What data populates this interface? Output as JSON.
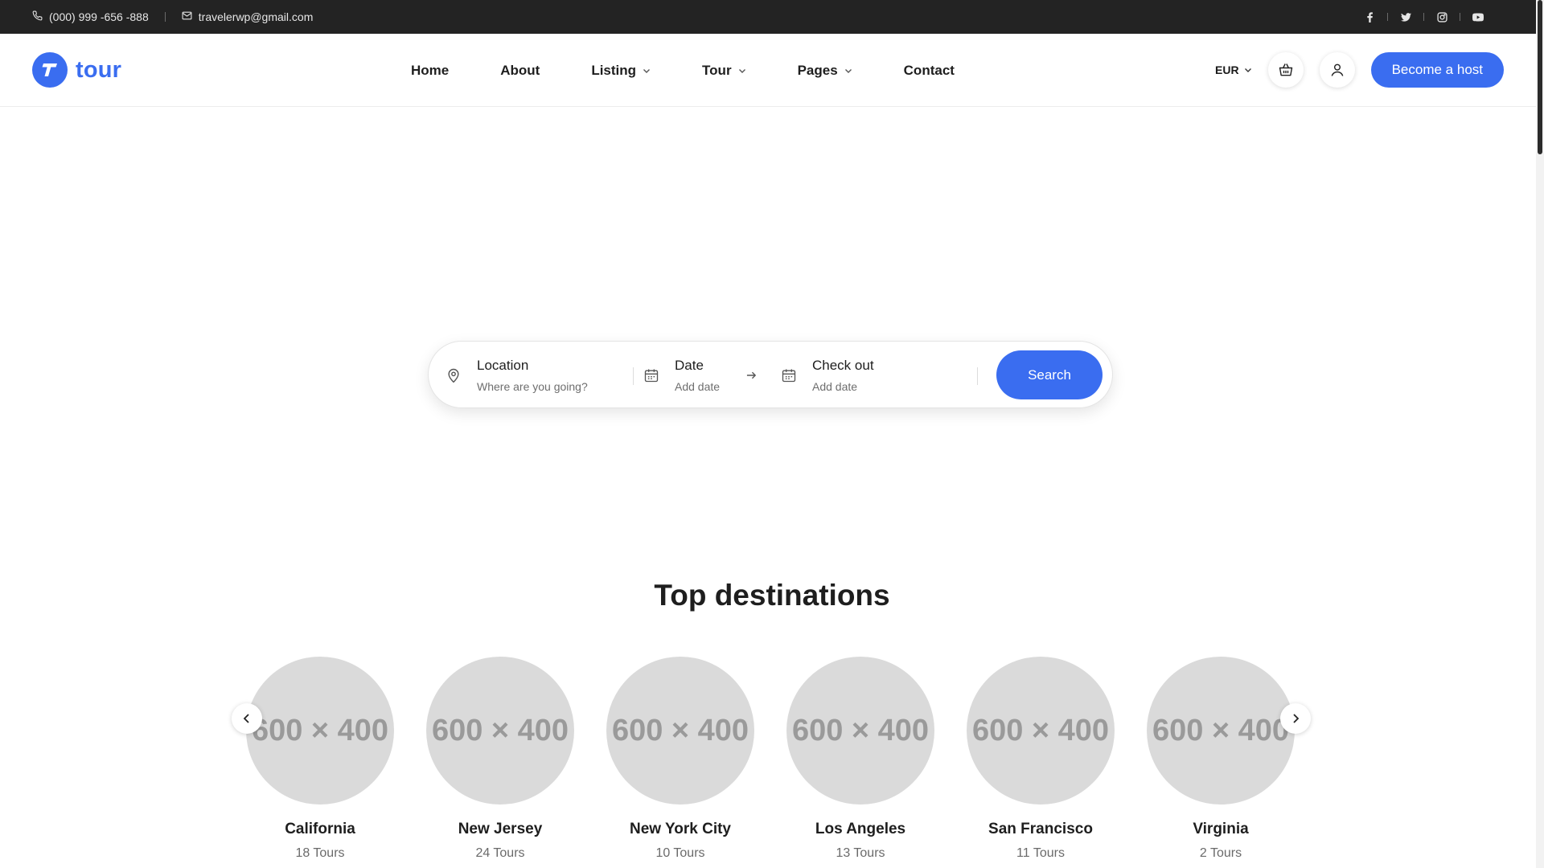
{
  "topbar": {
    "phone": "(000) 999 -656 -888",
    "email": "travelerwp@gmail.com",
    "social": [
      "facebook-icon",
      "twitter-icon",
      "instagram-icon",
      "youtube-icon"
    ]
  },
  "header": {
    "logo_text": "tour",
    "nav": [
      {
        "label": "Home",
        "dropdown": false
      },
      {
        "label": "About",
        "dropdown": false
      },
      {
        "label": "Listing",
        "dropdown": true
      },
      {
        "label": "Tour",
        "dropdown": true
      },
      {
        "label": "Pages",
        "dropdown": true
      },
      {
        "label": "Contact",
        "dropdown": false
      }
    ],
    "currency": "EUR",
    "become_host": "Become a host"
  },
  "search": {
    "location_label": "Location",
    "location_placeholder": "Where are you going?",
    "date_label": "Date",
    "date_placeholder": "Add date",
    "checkout_label": "Check out",
    "checkout_placeholder": "Add date",
    "button": "Search"
  },
  "destinations": {
    "title": "Top destinations",
    "image_placeholder": "600 × 400",
    "items": [
      {
        "name": "California",
        "count": "18 Tours"
      },
      {
        "name": "New Jersey",
        "count": "24 Tours"
      },
      {
        "name": "New York City",
        "count": "10 Tours"
      },
      {
        "name": "Los Angeles",
        "count": "13 Tours"
      },
      {
        "name": "San Francisco",
        "count": "11 Tours"
      },
      {
        "name": "Virginia",
        "count": "2 Tours"
      }
    ]
  },
  "colors": {
    "accent": "#3a6df0",
    "topbar_bg": "#232323",
    "placeholder_bg": "#dadada"
  }
}
